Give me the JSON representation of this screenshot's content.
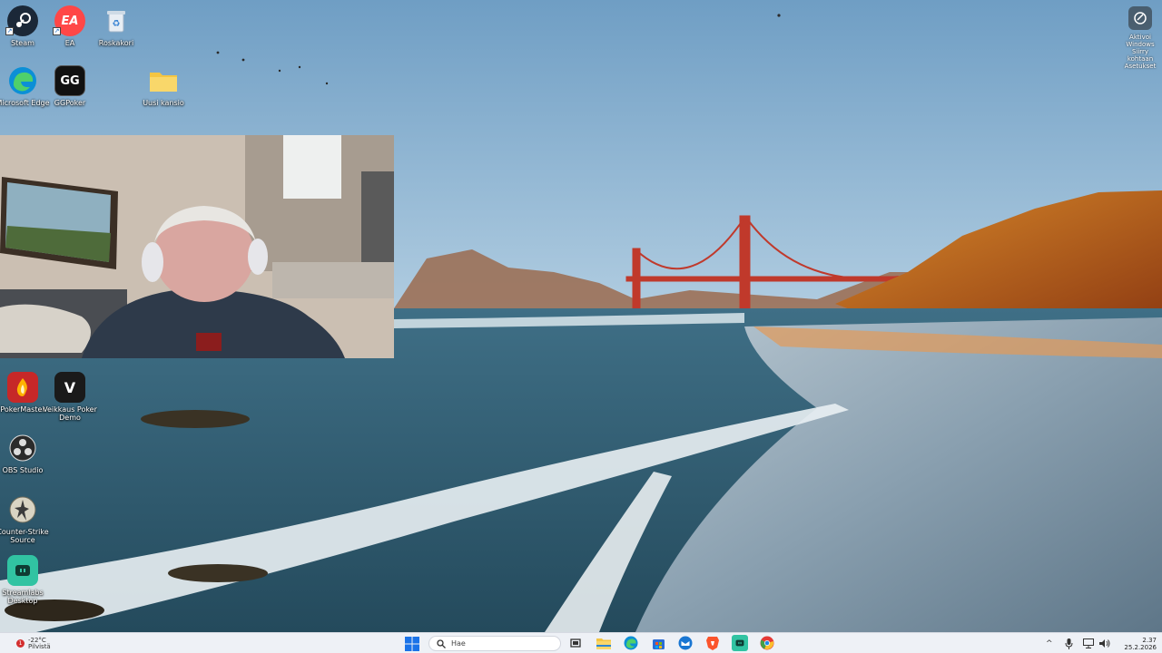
{
  "desktop": {
    "icons": [
      {
        "id": "steam",
        "label": "Steam",
        "icon": "steam-icon",
        "color": "#1b2838"
      },
      {
        "id": "ea",
        "label": "EA",
        "icon": "ea-icon",
        "color": "#ff4747"
      },
      {
        "id": "recycle",
        "label": "Roskakori",
        "icon": "recycle-bin-icon",
        "color": "#3a8fd9"
      },
      {
        "id": "edge",
        "label": "Microsoft Edge",
        "icon": "edge-icon",
        "color": "#0c8fd6"
      },
      {
        "id": "gg",
        "label": "GGPoker",
        "icon": "ggpoker-icon",
        "color": "#111111",
        "glyph": "GG"
      },
      {
        "id": "folder",
        "label": "Uusi kansio",
        "icon": "folder-icon",
        "color": "#f4c542"
      },
      {
        "id": "pokermaster",
        "label": "PokerMaster",
        "icon": "pokermaster-icon",
        "color": "#c62828"
      },
      {
        "id": "veikkaus",
        "label": "Veikkaus Poker Demo",
        "icon": "veikkaus-icon",
        "color": "#1a1a1a",
        "glyph": "V"
      },
      {
        "id": "obs",
        "label": "OBS Studio",
        "icon": "obs-icon",
        "color": "#2b2b2b"
      },
      {
        "id": "cs",
        "label": "Counter-Strike Source",
        "icon": "counter-strike-icon",
        "color": "#6d6a5a"
      },
      {
        "id": "streamlabs",
        "label": "Streamlabs Desktop",
        "icon": "streamlabs-icon",
        "color": "#31c3a2"
      }
    ]
  },
  "top_right_widget": {
    "icon": "settings-activation-icon",
    "label_line1": "Aktivoi Windows",
    "label_line2": "Siirry kohtaan Asetukset"
  },
  "taskbar": {
    "weather": {
      "badge": "1",
      "temp": "-22°C",
      "condition": "Pilvistä"
    },
    "search_placeholder": "Hae",
    "apps": [
      {
        "icon": "taskview-icon",
        "color": "#333333"
      },
      {
        "icon": "file-explorer-icon",
        "color": "#f4c542"
      },
      {
        "icon": "edge-icon",
        "color": "#0c8fd6"
      },
      {
        "icon": "store-icon",
        "color": "#2b6cd6"
      },
      {
        "icon": "mail-icon",
        "color": "#1976d2"
      },
      {
        "icon": "brave-icon",
        "color": "#fb542b"
      },
      {
        "icon": "streamlabs-icon",
        "color": "#31c3a2"
      },
      {
        "icon": "chrome-icon",
        "color": "#e53935"
      }
    ],
    "tray": {
      "chevron": "^",
      "time": "2.37",
      "date": "25.2.2026"
    }
  }
}
